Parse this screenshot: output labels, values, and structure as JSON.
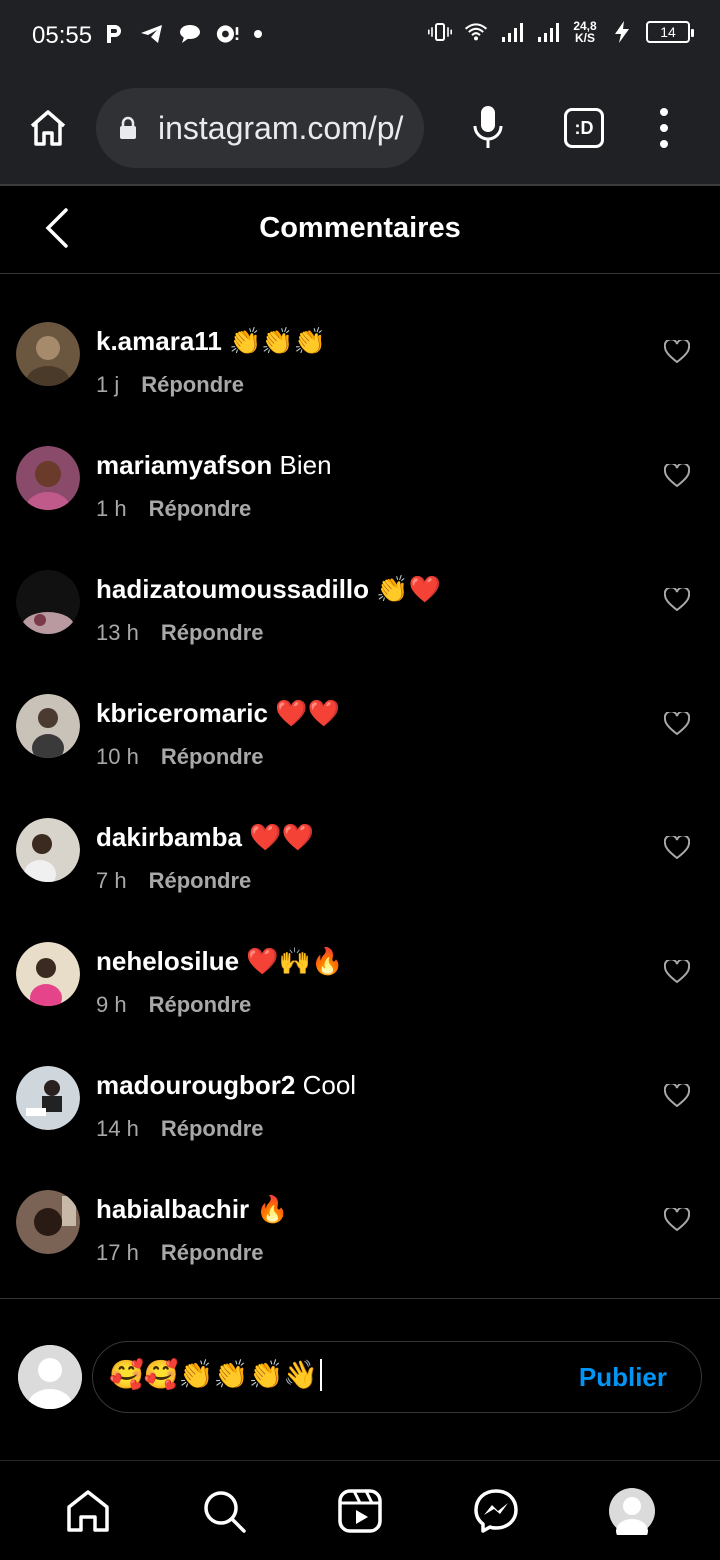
{
  "status_bar": {
    "time": "05:55",
    "net_speed_top": "24,8",
    "net_speed_bottom": "K/S",
    "battery": "14"
  },
  "browser": {
    "url": "instagram.com/p/",
    "tab_icon_label": ":D"
  },
  "header": {
    "title": "Commentaires"
  },
  "comments": [
    {
      "user": "k.amara11",
      "text": "👏👏👏",
      "time": "1 j",
      "reply": "Répondre",
      "avatar_color": "#6b5640"
    },
    {
      "user": "mariamyafson",
      "text": "Bien",
      "time": "1 h",
      "reply": "Répondre",
      "avatar_color": "#8a4a6a"
    },
    {
      "user": "hadizatoumoussadillo",
      "text": "👏❤️",
      "time": "13 h",
      "reply": "Répondre",
      "avatar_color": "#4a3a3a"
    },
    {
      "user": "kbriceromaric",
      "text": "❤️❤️",
      "time": "10 h",
      "reply": "Répondre",
      "avatar_color": "#c9c2b8"
    },
    {
      "user": "dakirbamba",
      "text": "❤️❤️",
      "time": "7 h",
      "reply": "Répondre",
      "avatar_color": "#d8d4cc"
    },
    {
      "user": "nehelosilue",
      "text": "❤️🙌🔥",
      "time": "9 h",
      "reply": "Répondre",
      "avatar_color": "#e7ddc9"
    },
    {
      "user": "madourougbor2",
      "text": "Cool",
      "time": "14 h",
      "reply": "Répondre",
      "avatar_color": "#cfd6dc"
    },
    {
      "user": "habialbachir",
      "text": "🔥",
      "time": "17 h",
      "reply": "Répondre",
      "avatar_color": "#7a6254"
    }
  ],
  "composer": {
    "value": "🥰🥰👏👏👏👋",
    "publish_label": "Publier"
  },
  "colors": {
    "accent": "#0095f6",
    "secondary_text": "#a8a8a8",
    "background": "#000000"
  },
  "nav": [
    "home-icon",
    "search-icon",
    "reels-icon",
    "messenger-icon",
    "profile-icon"
  ]
}
